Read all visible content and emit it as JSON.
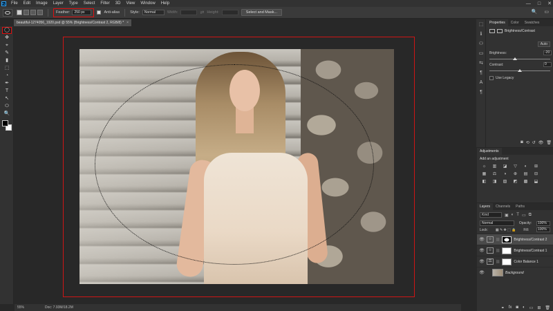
{
  "menu": [
    "File",
    "Edit",
    "Image",
    "Layer",
    "Type",
    "Select",
    "Filter",
    "3D",
    "View",
    "Window",
    "Help"
  ],
  "window_controls": [
    "—",
    "□",
    "✕"
  ],
  "options_bar": {
    "feather_label": "Feather:",
    "feather_value": "250 px",
    "anti_alias_label": "Anti-alias",
    "style_label": "Style:",
    "style_value": "Normal",
    "width_label": "Width:",
    "height_label": "Height:",
    "select_mask_label": "Select and Mask...",
    "right_icons": [
      "🔍",
      "▭"
    ]
  },
  "document_tab": {
    "title": "beautiful-1274056_1920.psd @ 55% (Brightness/Contrast 2, RGB/8) *",
    "close": "×"
  },
  "tools": [
    "◯",
    "✥",
    "⌖",
    "✎",
    "▮",
    "⬚",
    "◔",
    "✒",
    "T",
    "↖",
    "⬭",
    "🔍"
  ],
  "status": {
    "zoom": "55%",
    "doc": "Doc: 7.93M/18.2M"
  },
  "properties": {
    "tabs": [
      "Properties",
      "Color",
      "Swatches"
    ],
    "adjustment_title": "Brightness/Contrast",
    "auto_label": "Auto",
    "brightness_label": "Brightness:",
    "brightness_value": "-20",
    "contrast_label": "Contrast:",
    "contrast_value": "0",
    "brightness_fraction": 0.42,
    "contrast_fraction": 0.5,
    "use_legacy_label": "Use Legacy",
    "footer_icons": [
      "◙",
      "⟲",
      "↺",
      "👁",
      "🗑"
    ]
  },
  "icon_strip": [
    "⬚",
    "ℹ",
    "⚇",
    "▭",
    "⇆",
    "¶",
    "A",
    "¶"
  ],
  "adjustments": {
    "tab": "Adjustments",
    "add_label": "Add an adjustment",
    "icons": [
      "☼",
      "▥",
      "◪",
      "▽",
      "◐",
      "⊞",
      "▦",
      "⚖",
      "◑",
      "⊕",
      "▤",
      "⊟",
      "◧",
      "◨",
      "▨",
      "◩",
      "▩",
      "⬓"
    ]
  },
  "layers": {
    "tabs": [
      "Layers",
      "Channels",
      "Paths"
    ],
    "kind_label": "Kind",
    "blend_mode": "Normal",
    "opacity_label": "Opacity:",
    "opacity_value": "100%",
    "lock_label": "Lock:",
    "fill_label": "Fill:",
    "fill_value": "100%",
    "items": [
      {
        "name": "Brightness/Contrast 2",
        "selected": true
      },
      {
        "name": "Brightness/Contrast 1",
        "selected": false
      },
      {
        "name": "Color Balance 1",
        "selected": false
      },
      {
        "name": "Background",
        "selected": false
      }
    ],
    "footer_icons": [
      "⚭",
      "fx",
      "◙",
      "◐",
      "▭",
      "⊞",
      "🗑"
    ]
  }
}
